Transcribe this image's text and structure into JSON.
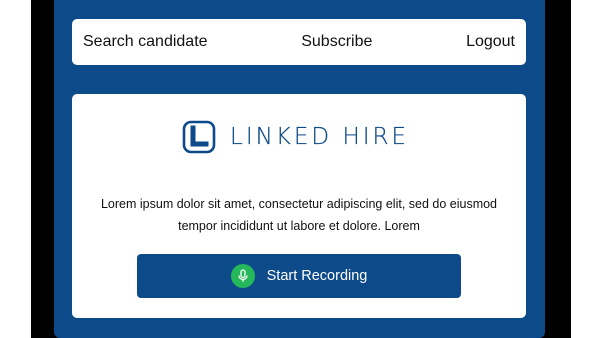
{
  "nav": {
    "search": "Search candidate",
    "subscribe": "Subscribe",
    "logout": "Logout"
  },
  "brand": {
    "name": "LINKED HIRE",
    "logo_icon": "linked-hire-logo-icon"
  },
  "card": {
    "description": "Lorem ipsum dolor sit amet, consectetur adipiscing elit, sed do eiusmod tempor incididunt ut labore et dolore. Lorem"
  },
  "record_button": {
    "label": "Start Recording",
    "icon": "microphone-icon"
  },
  "colors": {
    "primary": "#0d4a8a",
    "mic_green": "#25b85a",
    "frame": "#000000"
  }
}
